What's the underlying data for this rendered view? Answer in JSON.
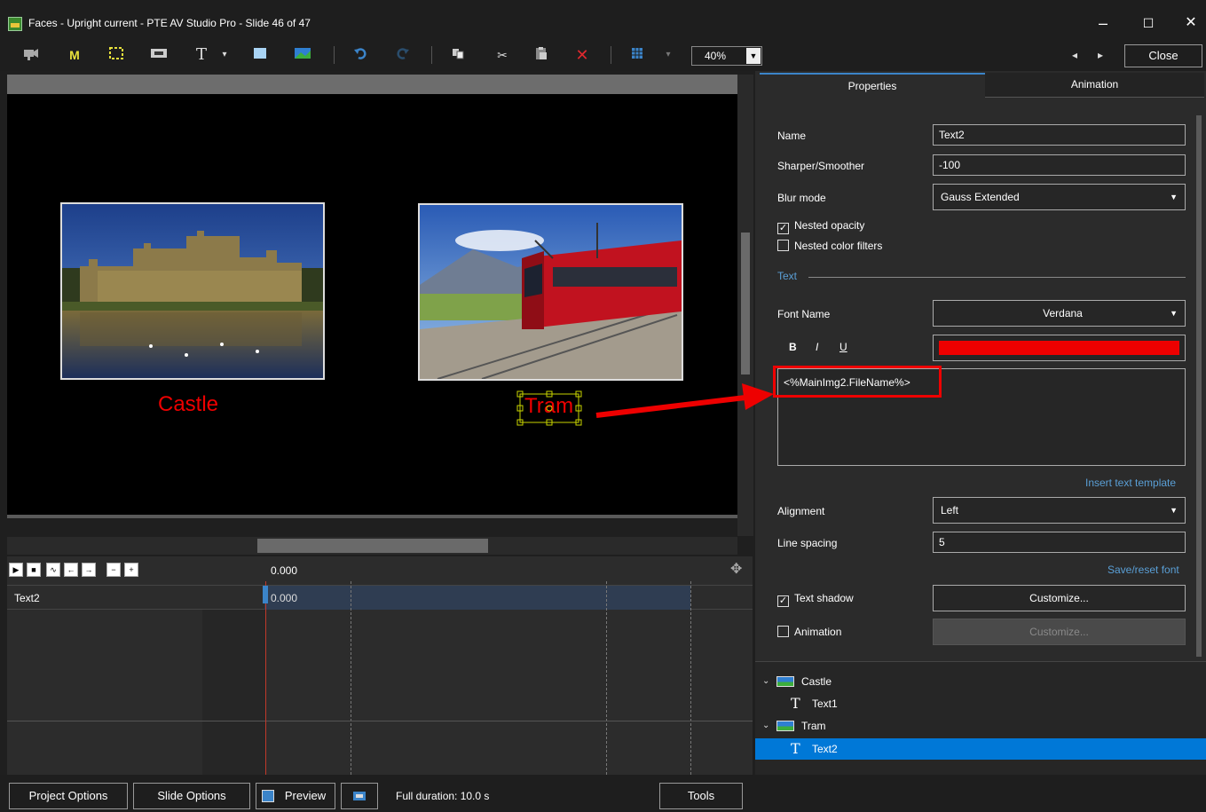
{
  "window": {
    "title": "Faces - Upright current - PTE AV Studio Pro - Slide 46 of 47",
    "minimize": "–",
    "maximize": "☐",
    "close": "✕"
  },
  "toolbar": {
    "menu_m": "M",
    "text_t": "T",
    "dropdown": "▾",
    "zoom": "40%",
    "prev": "◂",
    "next": "▸",
    "close_label": "Close"
  },
  "preview": {
    "caption_left": "Castle",
    "caption_right": "Tram"
  },
  "timeline": {
    "time_header": "0.000",
    "row_label": "Text2",
    "clip_time": "0.000"
  },
  "bottom": {
    "project_options": "Project Options",
    "slide_options": "Slide Options",
    "preview": "Preview",
    "duration": "Full duration: 10.0 s",
    "tools": "Tools"
  },
  "panel": {
    "tab_properties": "Properties",
    "tab_animation": "Animation",
    "name_label": "Name",
    "name_value": "Text2",
    "sharper_label": "Sharper/Smoother",
    "sharper_value": "-100",
    "blur_label": "Blur mode",
    "blur_value": "Gauss Extended",
    "nested_opacity": "Nested opacity",
    "nested_color_filters": "Nested color filters",
    "section_text": "Text",
    "font_name_label": "Font Name",
    "font_name_value": "Verdana",
    "bold": "B",
    "italic": "I",
    "underline": "U",
    "text_value": "<%MainImg2.FileName%>",
    "insert_template": "Insert text template",
    "alignment_label": "Alignment",
    "alignment_value": "Left",
    "line_spacing_label": "Line spacing",
    "line_spacing_value": "5",
    "save_reset_font": "Save/reset font",
    "text_shadow": "Text shadow",
    "customize": "Customize...",
    "animation": "Animation",
    "customize_disabled": "Customize..."
  },
  "tree": {
    "items": [
      {
        "label": "Castle"
      },
      {
        "label": "Text1"
      },
      {
        "label": "Tram"
      },
      {
        "label": "Text2"
      }
    ]
  },
  "colors": {
    "accent": "#0078d7",
    "text_color": "#e00000",
    "link": "#5a9fd6"
  }
}
